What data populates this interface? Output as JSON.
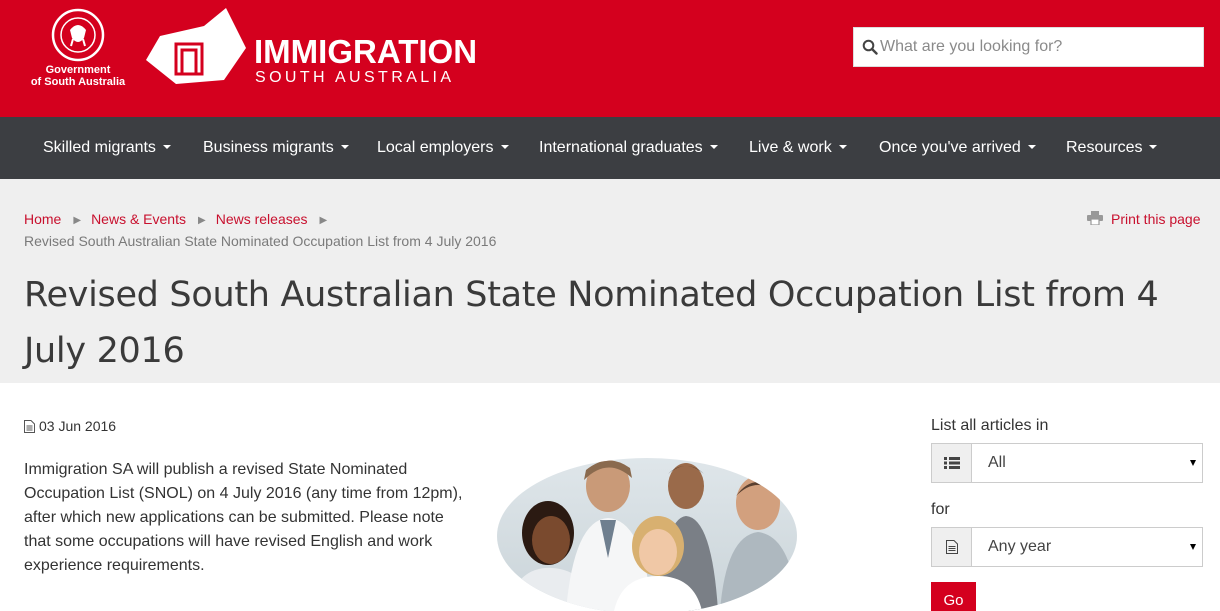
{
  "header": {
    "gov_logo_text_line1": "Government",
    "gov_logo_text_line2": "of South Australia",
    "crest_text": "SOUTH AUSTRALIA",
    "brand_title": "IMMIGRATION",
    "brand_subtitle": "SOUTH AUSTRALIA",
    "search": {
      "placeholder": "What are you looking for?",
      "value": ""
    },
    "brand_color": "#d4001e"
  },
  "nav": {
    "items": [
      {
        "label": "Skilled migrants"
      },
      {
        "label": "Business migrants"
      },
      {
        "label": "Local employers"
      },
      {
        "label": "International graduates"
      },
      {
        "label": "Live & work"
      },
      {
        "label": "Once you've arrived"
      },
      {
        "label": "Resources"
      }
    ],
    "bg_color": "#3c3e42"
  },
  "breadcrumb": {
    "items": [
      {
        "label": "Home"
      },
      {
        "label": "News & Events"
      },
      {
        "label": "News releases"
      }
    ],
    "current": "Revised South Australian State Nominated Occupation List from 4 July 2016"
  },
  "print_label": "Print this page",
  "article": {
    "title": "Revised South Australian State Nominated Occupation List from 4 July 2016",
    "date": "03 Jun 2016",
    "body": "Immigration SA will publish a revised State Nominated Occupation List (SNOL) on 4 July 2016 (any time from 12pm), after which new applications can be submitted. Please note that some occupations will have revised English and work experience requirements."
  },
  "sidebar": {
    "list_label": "List all articles in",
    "category_value": "All",
    "for_label": "for",
    "year_value": "Any year",
    "go_label": "Go"
  },
  "icons": {
    "search": "search-icon",
    "print": "printer-icon",
    "date": "document-icon",
    "category": "list-icon",
    "year": "document-icon"
  }
}
